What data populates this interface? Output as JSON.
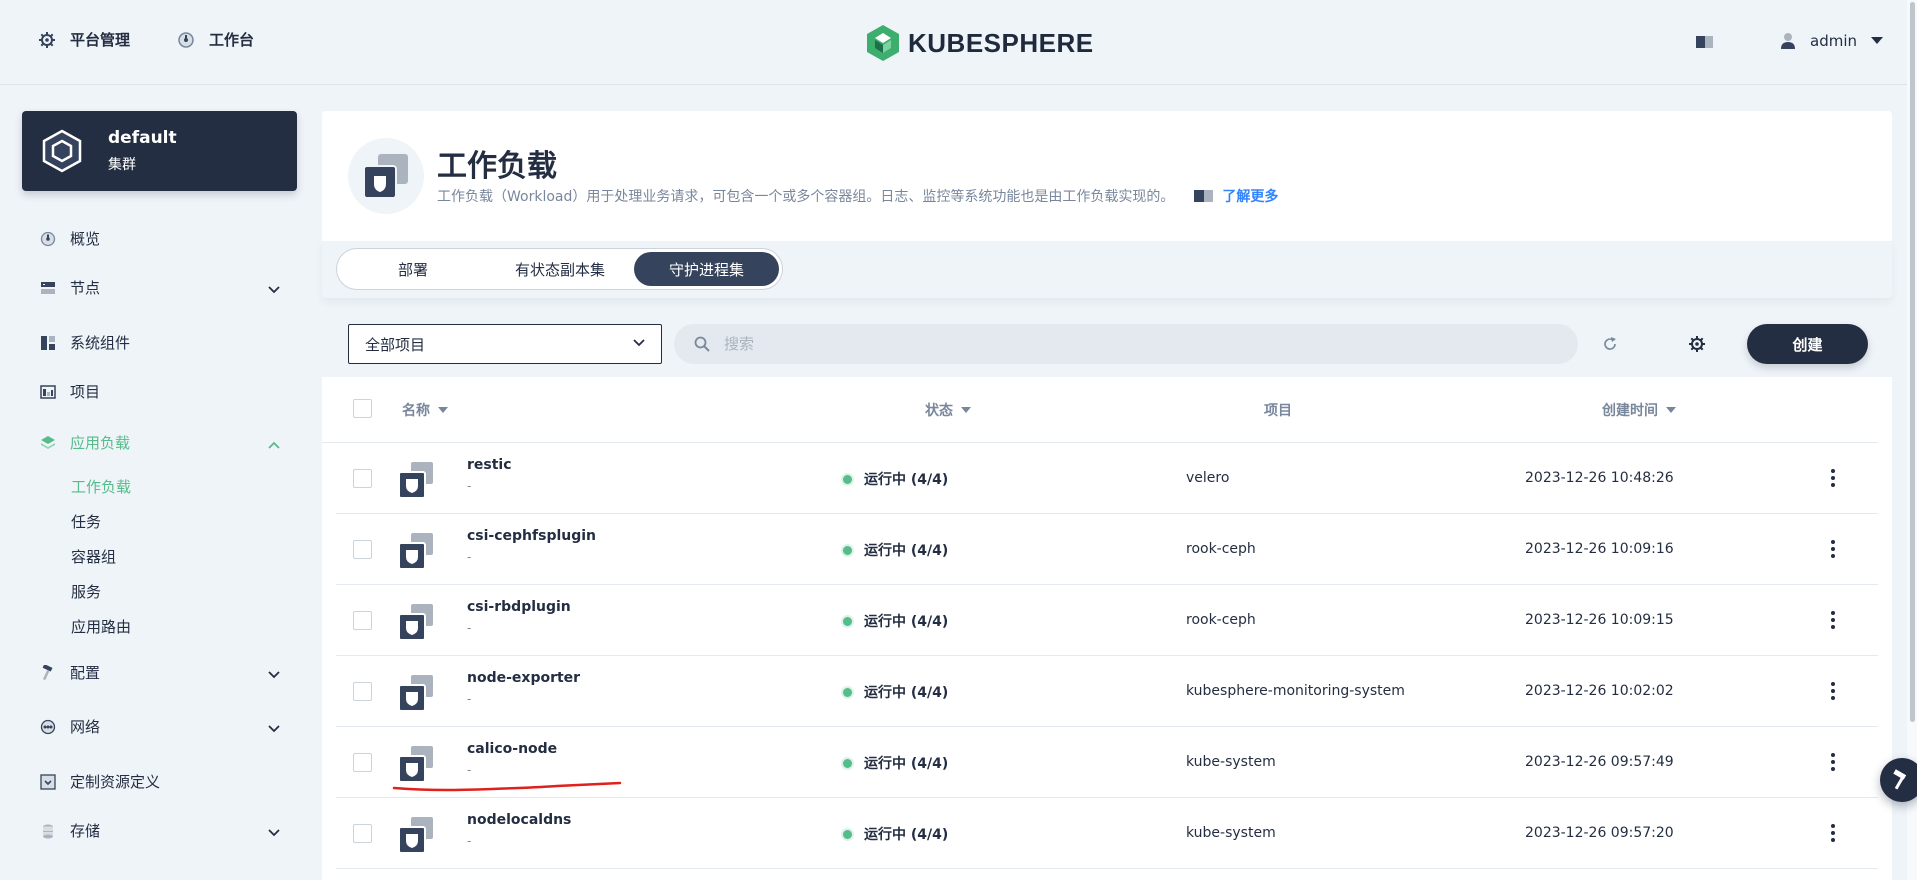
{
  "topbar": {
    "platform_label": "平台管理",
    "workbench_label": "工作台",
    "logo_text": "KUBESPHERE",
    "user_name": "admin"
  },
  "cluster": {
    "name": "default",
    "type": "集群"
  },
  "sidebar": {
    "items": [
      {
        "label": "概览",
        "icon": "overview-icon"
      },
      {
        "label": "节点",
        "icon": "nodes-icon"
      },
      {
        "label": "系统组件",
        "icon": "components-icon"
      },
      {
        "label": "项目",
        "icon": "project-icon"
      },
      {
        "label": "应用负载",
        "icon": "layers-icon"
      },
      {
        "label": "配置",
        "icon": "hammer-icon"
      },
      {
        "label": "网络",
        "icon": "network-icon"
      },
      {
        "label": "定制资源定义",
        "icon": "crd-icon"
      },
      {
        "label": "存储",
        "icon": "storage-icon"
      }
    ],
    "sub_items": [
      "工作负载",
      "任务",
      "容器组",
      "服务",
      "应用路由"
    ]
  },
  "header": {
    "title": "工作负载",
    "description": "工作负载（Workload）用于处理业务请求，可包含一个或多个容器组。日志、监控等系统功能也是由工作负载实现的。",
    "learn_more": "了解更多"
  },
  "tabs": [
    "部署",
    "有状态副本集",
    "守护进程集"
  ],
  "toolbar": {
    "project_select": "全部项目",
    "search_placeholder": "搜索",
    "create_label": "创建"
  },
  "table": {
    "columns": [
      "名称",
      "状态",
      "项目",
      "创建时间"
    ],
    "rows": [
      {
        "name": "restic",
        "sub": "-",
        "status": "运行中 (4/4)",
        "project": "velero",
        "created": "2023-12-26 10:48:26"
      },
      {
        "name": "csi-cephfsplugin",
        "sub": "-",
        "status": "运行中 (4/4)",
        "project": "rook-ceph",
        "created": "2023-12-26 10:09:16"
      },
      {
        "name": "csi-rbdplugin",
        "sub": "-",
        "status": "运行中 (4/4)",
        "project": "rook-ceph",
        "created": "2023-12-26 10:09:15"
      },
      {
        "name": "node-exporter",
        "sub": "-",
        "status": "运行中 (4/4)",
        "project": "kubesphere-monitoring-system",
        "created": "2023-12-26 10:02:02"
      },
      {
        "name": "calico-node",
        "sub": "-",
        "status": "运行中 (4/4)",
        "project": "kube-system",
        "created": "2023-12-26 09:57:49"
      },
      {
        "name": "nodelocaldns",
        "sub": "-",
        "status": "运行中 (4/4)",
        "project": "kube-system",
        "created": "2023-12-26 09:57:20"
      }
    ]
  },
  "colors": {
    "dark": "#242e42",
    "accent_green": "#55bc8a",
    "link_blue": "#3385ff",
    "background": "#eff4f9",
    "annotation_red": "#e0201b"
  }
}
